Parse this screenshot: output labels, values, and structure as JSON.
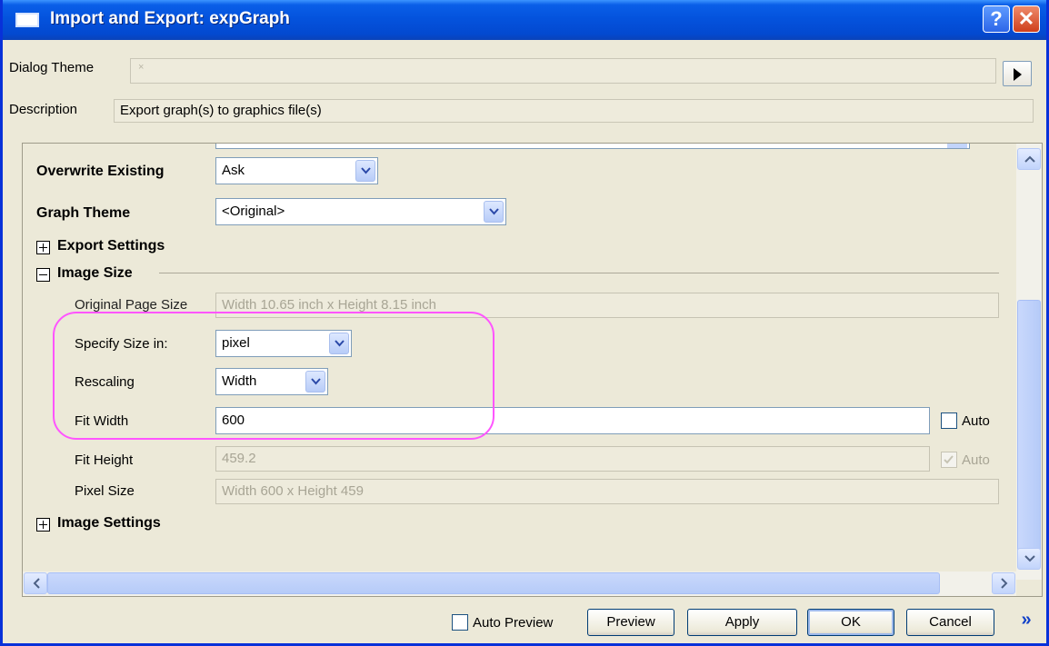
{
  "window": {
    "title": "Import and Export: expGraph",
    "help_glyph": "?",
    "close_glyph": "✕"
  },
  "theme": {
    "label": "Dialog Theme",
    "value": "×"
  },
  "description": {
    "label": "Description",
    "value": "Export graph(s) to graphics file(s)"
  },
  "settings": {
    "overwrite": {
      "label": "Overwrite Existing",
      "value": "Ask"
    },
    "graph_theme": {
      "label": "Graph Theme",
      "value": "<Original>"
    },
    "export_settings": {
      "label": "Export Settings"
    },
    "image_size": {
      "label": "Image Size",
      "original_page_size": {
        "label": "Original Page Size",
        "value": "Width 10.65 inch x Height 8.15 inch"
      },
      "specify_size": {
        "label": "Specify Size in:",
        "value": "pixel"
      },
      "rescaling": {
        "label": "Rescaling",
        "value": "Width"
      },
      "fit_width": {
        "label": "Fit Width",
        "value": "600",
        "auto_label": "Auto",
        "auto_checked": false
      },
      "fit_height": {
        "label": "Fit Height",
        "value": "459.2",
        "auto_label": "Auto",
        "auto_checked": true
      },
      "pixel_size": {
        "label": "Pixel Size",
        "value": "Width 600 x Height 459"
      }
    },
    "image_settings": {
      "label": "Image Settings"
    }
  },
  "footer": {
    "auto_preview": "Auto Preview",
    "preview": "Preview",
    "apply": "Apply",
    "ok": "OK",
    "cancel": "Cancel",
    "more": "»"
  },
  "colors": {
    "highlight": "#ff55ff",
    "titlebar": "#0453dd",
    "dialog_bg": "#ece9d8"
  }
}
